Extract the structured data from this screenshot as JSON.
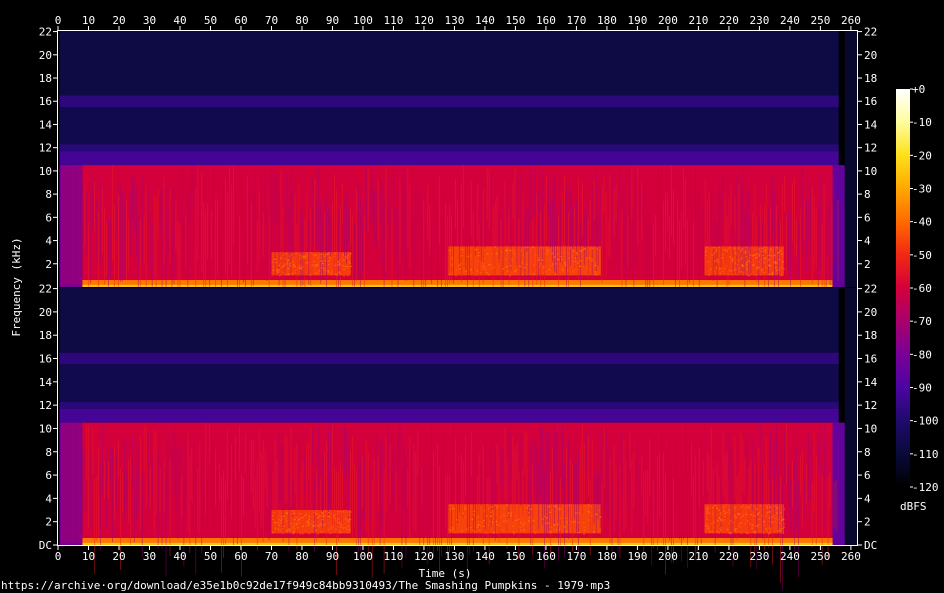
{
  "source_url": "https://archive·org/download/e35e1b0c92de17f949c84bb9310493/The Smashing Pumpkins - 1979·mp3",
  "chart_data": {
    "type": "heatmap",
    "title": "",
    "xlabel": "Time (s)",
    "ylabel": "Frequency (kHz)",
    "colorbar_label": "dBFS",
    "xlim": [
      0,
      262
    ],
    "ylim": [
      0,
      22.05
    ],
    "x_ticks": [
      0,
      10,
      20,
      30,
      40,
      50,
      60,
      70,
      80,
      90,
      100,
      110,
      120,
      130,
      140,
      150,
      160,
      170,
      180,
      190,
      200,
      210,
      220,
      230,
      240,
      250,
      260
    ],
    "y_ticks": [
      {
        "value": 0,
        "label": "DC"
      },
      {
        "value": 2,
        "label": "2"
      },
      {
        "value": 4,
        "label": "4"
      },
      {
        "value": 6,
        "label": "6"
      },
      {
        "value": 8,
        "label": "8"
      },
      {
        "value": 10,
        "label": "10"
      },
      {
        "value": 12,
        "label": "12"
      },
      {
        "value": 14,
        "label": "14"
      },
      {
        "value": 16,
        "label": "16"
      },
      {
        "value": 18,
        "label": "18"
      },
      {
        "value": 20,
        "label": "20"
      },
      {
        "value": 22,
        "label": "22"
      }
    ],
    "colorbar": {
      "range": [
        -120,
        0
      ],
      "ticks": [
        {
          "value": 0,
          "label": "+0"
        },
        {
          "value": -10,
          "label": "-10"
        },
        {
          "value": -20,
          "label": "-20"
        },
        {
          "value": -30,
          "label": "-30"
        },
        {
          "value": -40,
          "label": "-40"
        },
        {
          "value": -50,
          "label": "-50"
        },
        {
          "value": -60,
          "label": "-60"
        },
        {
          "value": -70,
          "label": "-70"
        },
        {
          "value": -80,
          "label": "-80"
        },
        {
          "value": -90,
          "label": "-90"
        },
        {
          "value": -100,
          "label": "-100"
        },
        {
          "value": -110,
          "label": "-110"
        },
        {
          "value": -120,
          "label": "-120"
        }
      ],
      "stops": [
        {
          "value": 0,
          "color": "#ffffff"
        },
        {
          "value": -10,
          "color": "#fffd9c"
        },
        {
          "value": -20,
          "color": "#ffe01a"
        },
        {
          "value": -30,
          "color": "#ffa800"
        },
        {
          "value": -40,
          "color": "#ff6a00"
        },
        {
          "value": -50,
          "color": "#f22814"
        },
        {
          "value": -60,
          "color": "#d4003c"
        },
        {
          "value": -70,
          "color": "#a8006c"
        },
        {
          "value": -80,
          "color": "#780096"
        },
        {
          "value": -90,
          "color": "#4d04a2"
        },
        {
          "value": -100,
          "color": "#1e0a6c"
        },
        {
          "value": -110,
          "color": "#0a0a3a"
        },
        {
          "value": -120,
          "color": "#000000"
        }
      ]
    },
    "channels": 2,
    "lowpass_cutoff_khz": 10.5,
    "audio_start_s": 0.5,
    "audio_end_s": 256,
    "intro_end_s": 8,
    "intensity_regions": [
      {
        "t0": 0,
        "t1": 0.5,
        "f0": 0,
        "f1": 22.05,
        "db": -125
      },
      {
        "t0": 0.5,
        "t1": 256,
        "f0": 16.5,
        "f1": 22.05,
        "db": -108
      },
      {
        "t0": 0.5,
        "t1": 256,
        "f0": 15.5,
        "f1": 16.5,
        "db": -97
      },
      {
        "t0": 0.5,
        "t1": 256,
        "f0": 12.3,
        "f1": 15.5,
        "db": -106
      },
      {
        "t0": 0.5,
        "t1": 256,
        "f0": 11.7,
        "f1": 12.3,
        "db": -98
      },
      {
        "t0": 0.5,
        "t1": 256,
        "f0": 10.5,
        "f1": 11.7,
        "db": -92
      },
      {
        "t0": 0.5,
        "t1": 8,
        "f0": 0,
        "f1": 10.5,
        "db": -80
      },
      {
        "t0": 8,
        "t1": 256,
        "f0": 0,
        "f1": 10.5,
        "db": -60
      },
      {
        "t0": 8,
        "t1": 256,
        "f0": 0.2,
        "f1": 0.6,
        "db": -38
      },
      {
        "t0": 8,
        "t1": 256,
        "f0": 0,
        "f1": 0.2,
        "db": -25
      },
      {
        "t0": 70,
        "t1": 96,
        "f0": 1.0,
        "f1": 3.0,
        "db": -47
      },
      {
        "t0": 128,
        "t1": 178,
        "f0": 1.0,
        "f1": 3.5,
        "db": -46
      },
      {
        "t0": 212,
        "t1": 238,
        "f0": 1.0,
        "f1": 3.5,
        "db": -47
      },
      {
        "t0": 254,
        "t1": 258,
        "f0": 0,
        "f1": 10.5,
        "db": -85
      },
      {
        "t0": 258,
        "t1": 262,
        "f0": 0,
        "f1": 22.05,
        "db": -112
      }
    ]
  }
}
